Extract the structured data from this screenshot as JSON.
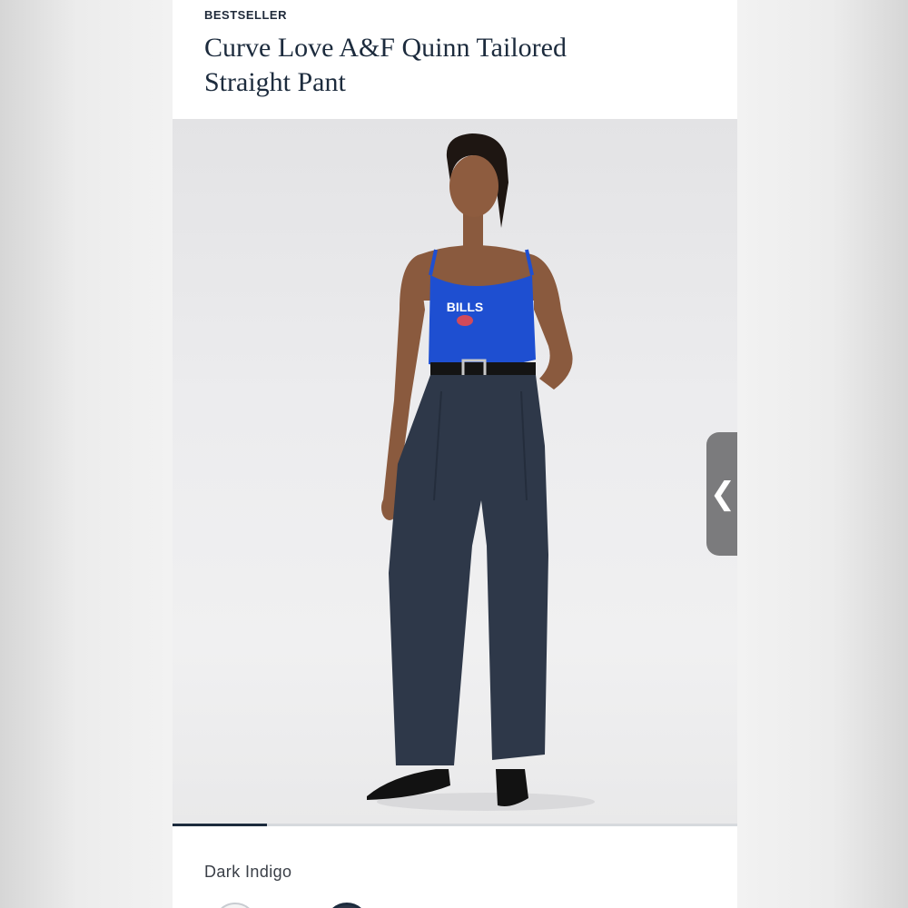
{
  "product": {
    "badge": "BESTSELLER",
    "title_line1": "Curve Love A&F Quinn Tailored",
    "title_line2": "Straight Pant",
    "image_print_text": "BILLS",
    "gallery_progress": 0.167,
    "color_label": "Dark Indigo"
  },
  "icons": {
    "side_tab": "chevron-left-icon",
    "side_tab_glyph": "❮"
  },
  "colors": {
    "text_dark": "#1c2b3d",
    "tank_top": "#1e4fd1",
    "pants": "#2e3849",
    "tab": "#7b7b7d"
  }
}
